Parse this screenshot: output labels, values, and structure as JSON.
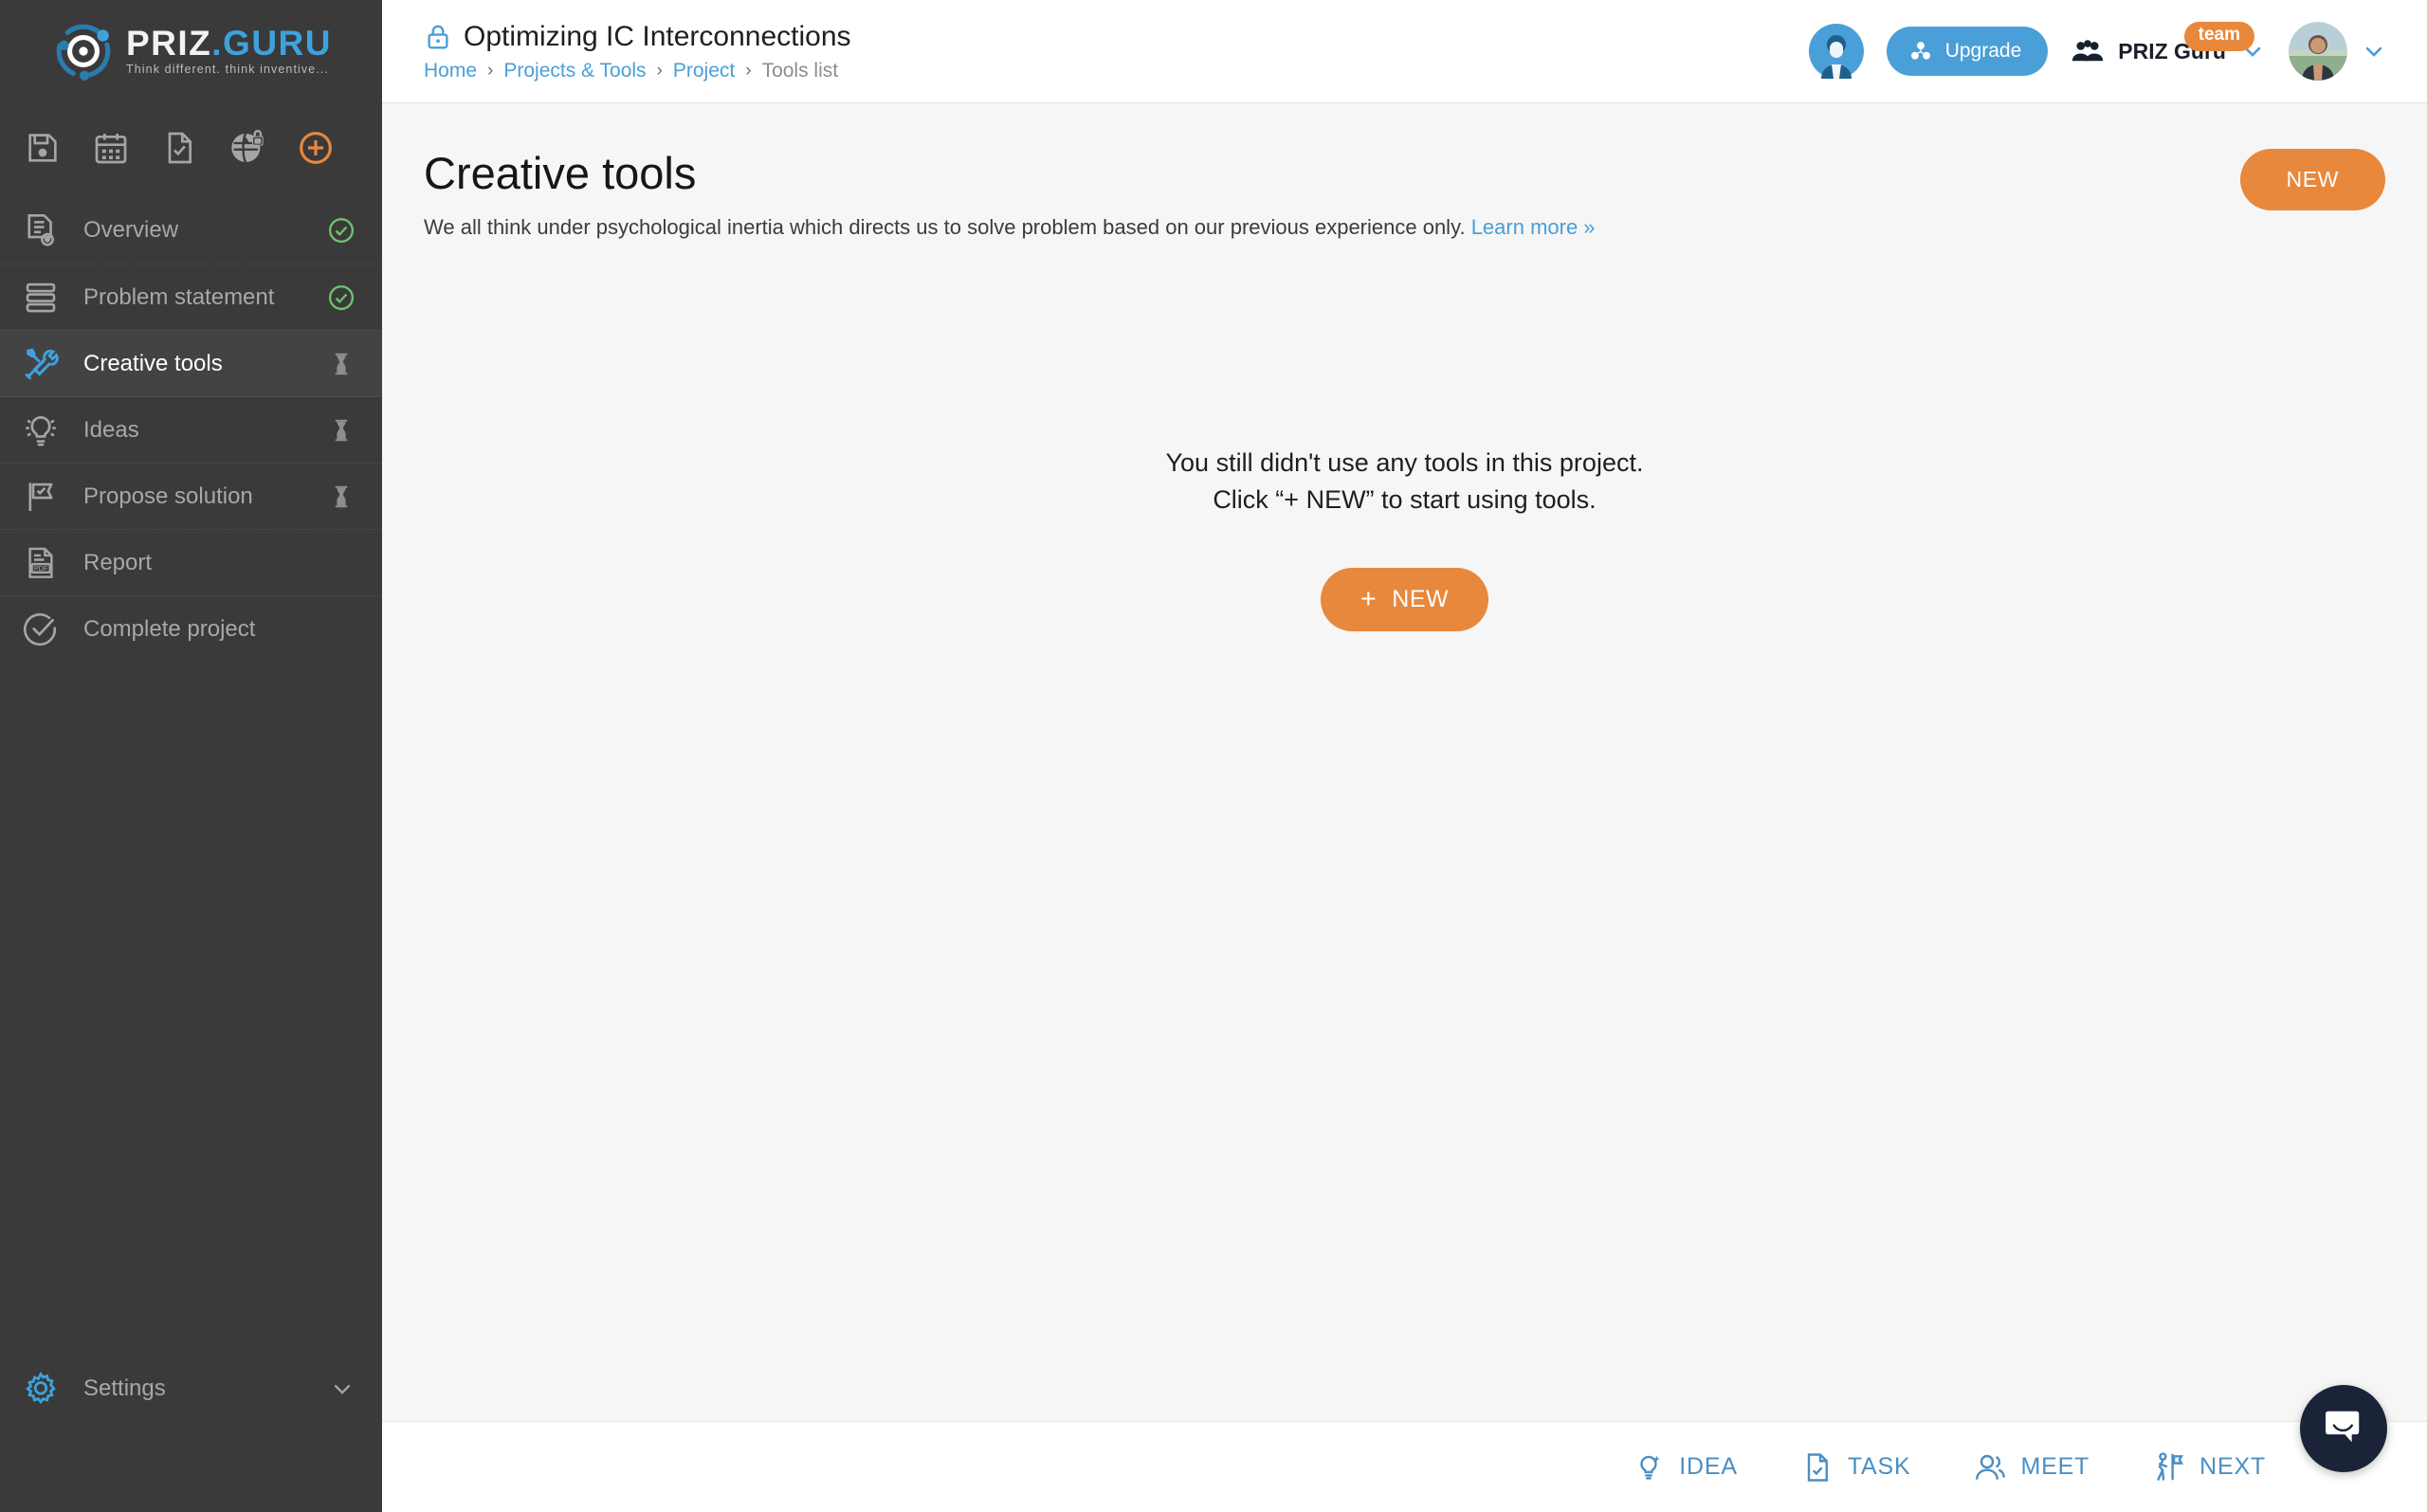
{
  "brand": {
    "name_first": "PRIZ",
    "name_second": ".GURU",
    "tagline": "Think different. think inventive...",
    "logo_icon": "priz-logo-icon",
    "accent_blue": "#3ea2dd",
    "accent_orange": "#e8883c",
    "sidebar_bg": "#3a3a3a"
  },
  "sidebar": {
    "quick_icons": [
      {
        "name": "save-icon",
        "title": "Save"
      },
      {
        "name": "calendar-icon",
        "title": "Calendar"
      },
      {
        "name": "document-check-icon",
        "title": "Tasks"
      },
      {
        "name": "globe-lock-icon",
        "title": "Privacy"
      },
      {
        "name": "add-circle-icon",
        "title": "Add"
      }
    ],
    "items": [
      {
        "label": "Overview",
        "icon": "overview-icon",
        "status": "done",
        "active": false
      },
      {
        "label": "Problem statement",
        "icon": "problem-statement-icon",
        "status": "done",
        "active": false
      },
      {
        "label": "Creative tools",
        "icon": "creative-tools-icon",
        "status": "pending",
        "active": true
      },
      {
        "label": "Ideas",
        "icon": "idea-bulb-icon",
        "status": "pending",
        "active": false
      },
      {
        "label": "Propose solution",
        "icon": "flag-check-icon",
        "status": "pending",
        "active": false
      },
      {
        "label": "Report",
        "icon": "pdf-report-icon",
        "status": "none",
        "active": false
      },
      {
        "label": "Complete project",
        "icon": "check-circle-icon",
        "status": "none",
        "active": false
      }
    ],
    "settings": {
      "label": "Settings",
      "icon": "gear-icon",
      "chevron": "chevron-down-icon"
    }
  },
  "topbar": {
    "lock_icon": "lock-icon",
    "project_title": "Optimizing IC Interconnections",
    "breadcrumbs": [
      {
        "label": "Home",
        "current": false
      },
      {
        "label": "Projects & Tools",
        "current": false
      },
      {
        "label": "Project",
        "current": false
      },
      {
        "label": "Tools list",
        "current": true
      }
    ],
    "breadcrumb_separator": "›",
    "bot_avatar": "assistant-avatar",
    "upgrade": {
      "label": "Upgrade",
      "icon": "upgrade-blocks-icon"
    },
    "team": {
      "name": "PRIZ Guru",
      "badge": "team",
      "icon": "team-people-icon",
      "chevron": "chevron-down-icon"
    },
    "user": {
      "avatar": "user-avatar",
      "chevron": "chevron-down-icon"
    }
  },
  "page": {
    "title": "Creative tools",
    "subtitle": "We all think under psychological inertia which directs us to solve problem based on our previous experience only.",
    "learn_more": "Learn more »",
    "new_button": "NEW"
  },
  "empty_state": {
    "line1": "You still didn't use any tools in this project.",
    "line2": "Click “+ NEW” to start using tools.",
    "button_plus": "+",
    "button_label": "NEW"
  },
  "footer": {
    "actions": [
      {
        "label": "IDEA",
        "icon": "idea-bulb-icon"
      },
      {
        "label": "TASK",
        "icon": "task-document-icon"
      },
      {
        "label": "MEET",
        "icon": "meet-people-icon"
      },
      {
        "label": "NEXT",
        "icon": "next-flag-person-icon"
      }
    ]
  },
  "chat": {
    "icon": "chat-bubble-icon"
  }
}
